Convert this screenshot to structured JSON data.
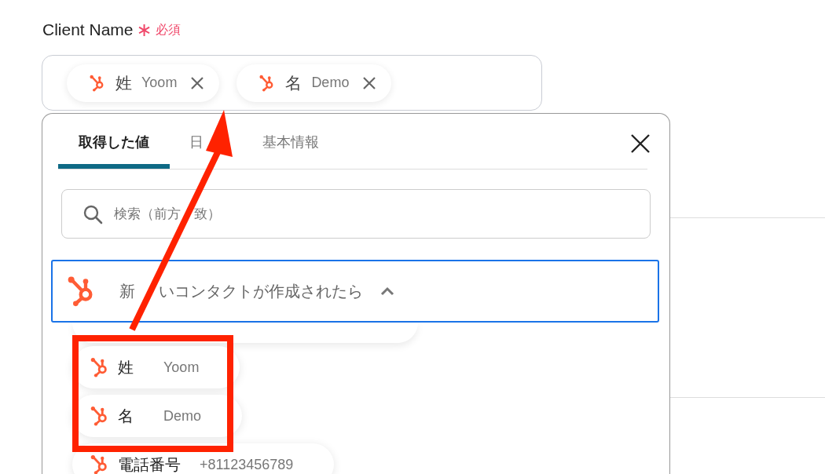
{
  "field": {
    "label": "Client Name",
    "required_mark": "∗",
    "required_text": "必須",
    "tags": [
      {
        "key": "姓",
        "value": "Yoom"
      },
      {
        "key": "名",
        "value": "Demo"
      }
    ]
  },
  "panel": {
    "tabs": [
      {
        "label": "取得した値",
        "selected": true
      },
      {
        "label": "日",
        "selected": false
      },
      {
        "label": "基本情報",
        "selected": false
      }
    ],
    "search": {
      "placeholder_parts": [
        "検索（前方",
        "致）"
      ]
    },
    "group": {
      "title_parts": [
        "新",
        "いコンタクトが作成されたら"
      ],
      "expanded": true,
      "items": [
        {
          "kind": "stub"
        },
        {
          "key": "姓",
          "value": "Yoom",
          "kind": "normal"
        },
        {
          "key": "名",
          "value": "Demo",
          "kind": "normal"
        },
        {
          "key": "電話番号",
          "value": "+81123456789",
          "kind": "normal"
        }
      ]
    }
  }
}
